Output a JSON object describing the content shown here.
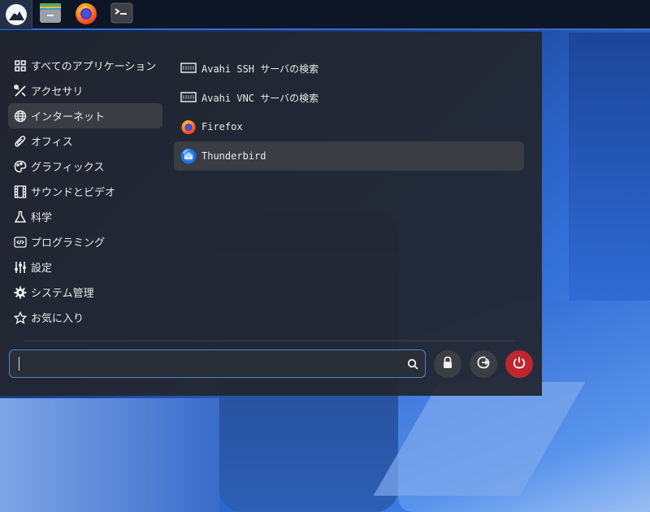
{
  "taskbar": {
    "start": {
      "icon": "distro-logo-icon"
    },
    "apps": [
      {
        "name": "file-manager",
        "icon": "file-manager-icon"
      },
      {
        "name": "firefox",
        "icon": "firefox-icon"
      },
      {
        "name": "terminal",
        "icon": "terminal-icon"
      }
    ]
  },
  "categories": [
    {
      "label": "すべてのアプリケーション",
      "icon": "grid-icon"
    },
    {
      "label": "アクセサリ",
      "icon": "tools-icon"
    },
    {
      "label": "インターネット",
      "icon": "globe-icon",
      "active": true
    },
    {
      "label": "オフィス",
      "icon": "paperclip-icon"
    },
    {
      "label": "グラフィックス",
      "icon": "palette-icon"
    },
    {
      "label": "サウンドとビデオ",
      "icon": "film-icon"
    },
    {
      "label": "科学",
      "icon": "flask-icon"
    },
    {
      "label": "プログラミング",
      "icon": "code-icon"
    },
    {
      "label": "設定",
      "icon": "sliders-icon"
    },
    {
      "label": "システム管理",
      "icon": "gear-icon"
    },
    {
      "label": "お気に入り",
      "icon": "star-icon"
    }
  ],
  "apps": [
    {
      "label": "Avahi SSH サーバの検索",
      "icon": "network-icon"
    },
    {
      "label": "Avahi VNC サーバの検索",
      "icon": "network-icon"
    },
    {
      "label": "Firefox",
      "icon": "firefox-icon"
    },
    {
      "label": "Thunderbird",
      "icon": "thunderbird-icon",
      "active": true
    }
  ],
  "search": {
    "value": "",
    "placeholder": ""
  },
  "buttons": {
    "lock": "lock-icon",
    "logout": "logout-icon",
    "power": "power-icon"
  },
  "colors": {
    "accent": "#4e86d8",
    "power": "#c1252f",
    "panel": "#22262e"
  }
}
